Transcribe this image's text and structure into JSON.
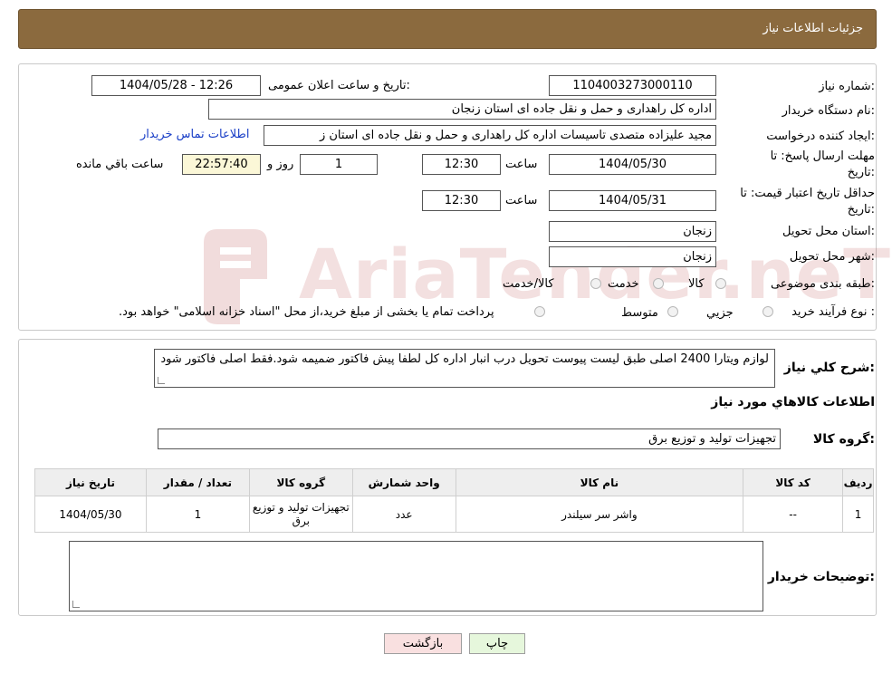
{
  "header": {
    "title": "جزئیات اطلاعات نیاز"
  },
  "form": {
    "need_number_label": "شماره نیاز:",
    "need_number": "1104003273000110",
    "announce_label": "تاریخ و ساعت اعلان عمومی:",
    "announce_value": "1404/05/28 - 12:26",
    "buyer_org_label": "نام دستگاه خریدار:",
    "buyer_org": "اداره کل راهداری و حمل و نقل جاده ای استان زنجان",
    "creator_label": "ایجاد کننده درخواست:",
    "creator": "مجید علیزاده متصدی تاسیسات اداره کل راهداری و حمل و نقل جاده ای استان ز",
    "contact_link": "اطلاعات تماس خریدار",
    "deadline_label_1": "مهلت ارسال پاسخ: تا",
    "deadline_label_2": "تاریخ:",
    "deadline_date": "1404/05/30",
    "time_label": "ساعت",
    "deadline_time": "12:30",
    "days_value": "1",
    "days_label": "روز و",
    "remaining_time": "22:57:40",
    "remaining_label": "ساعت باقي مانده",
    "validity_label_1": "حداقل تاریخ اعتبار قیمت: تا",
    "validity_label_2": "تاریخ:",
    "validity_date": "1404/05/31",
    "validity_time": "12:30",
    "province_label": "استان محل تحویل:",
    "province": "زنجان",
    "city_label": "شهر محل تحویل:",
    "city": "زنجان",
    "category_label": "طبقه بندی موضوعی:",
    "category_options": [
      "کالا",
      "خدمت",
      "کالا/خدمت"
    ],
    "purchase_type_label": "نوع فرآیند خرید :",
    "purchase_type_options": [
      "جزیي",
      "متوسط"
    ],
    "purchase_note": "پرداخت تمام یا بخشی از مبلغ خرید،از محل \"اسناد خزانه اسلامی\" خواهد بود."
  },
  "details": {
    "general_desc_label": "شرح کلي نياز:",
    "general_desc": "لوازم ویتارا 2400 اصلی طبق لیست پیوست تحویل درب انبار اداره کل لطفا پیش فاکتور ضمیمه شود.فقط اصلی فاکتور شود",
    "goods_info_title": "اطلاعات کالاهاي مورد نياز",
    "goods_group_label": "گروه کالا:",
    "goods_group": "تجهیزات تولید و توزیع برق"
  },
  "table": {
    "headers": [
      "رديف",
      "کد کالا",
      "نام کالا",
      "واحد شمارش",
      "گروه کالا",
      "تعداد / مقدار",
      "تاریخ نیاز"
    ],
    "rows": [
      {
        "index": "1",
        "code": "--",
        "name": "واشر سر سیلندر",
        "unit": "عدد",
        "group": "تجهیزات تولید و توزیع برق",
        "qty": "1",
        "date": "1404/05/30"
      }
    ]
  },
  "notes": {
    "label": "توضیحات خریدار:",
    "value": ""
  },
  "buttons": {
    "print": "چاپ",
    "back": "بازگشت"
  },
  "watermark": {
    "text": "AriaTender.neT"
  },
  "colors": {
    "header_bg": "#8b6a3e",
    "link": "#1a3fc7",
    "print_bg": "#e6f7dc",
    "back_bg": "#f9e0e0",
    "highlight": "#fbf7d7"
  }
}
